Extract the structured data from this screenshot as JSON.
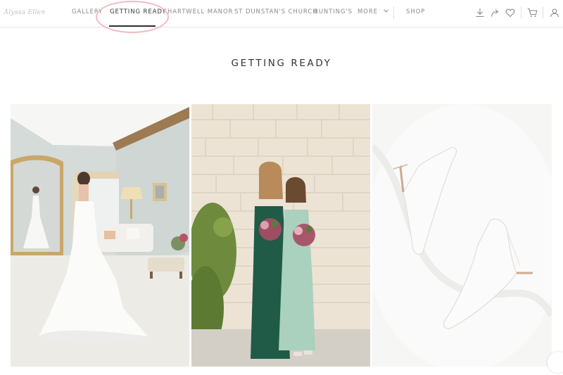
{
  "brand": {
    "logo_text": "Alyssa Ellen"
  },
  "nav": {
    "items": [
      {
        "label": "GALLERY"
      },
      {
        "label": "GETTING READY"
      },
      {
        "label": "HARTWELL MANOR"
      },
      {
        "label": "ST DUNSTAN'S CHURCH"
      },
      {
        "label": "BUNTING'S"
      },
      {
        "label": "MORE"
      },
      {
        "label": "SHOP"
      }
    ],
    "active_label": "GETTING READY"
  },
  "toolbar_icons": [
    "download-icon",
    "share-icon",
    "favorite-icon",
    "cart-icon",
    "account-icon"
  ],
  "page": {
    "title": "GETTING READY"
  },
  "photos": [
    {
      "subject": "bride-mirror"
    },
    {
      "subject": "bridesmaids"
    },
    {
      "subject": "bridal-shoes"
    }
  ],
  "colors": {
    "highlight_ring": "#f3b8c2",
    "active_underline": "#333333"
  }
}
